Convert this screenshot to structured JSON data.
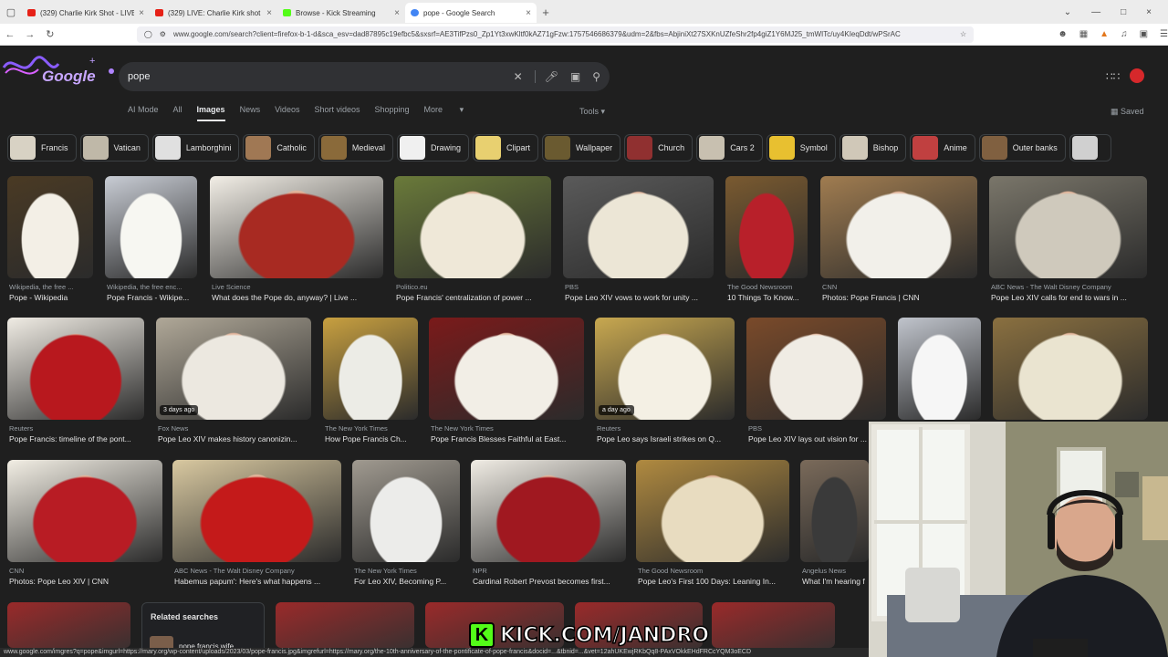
{
  "browser": {
    "tabs": [
      {
        "title": "(329) Charlie Kirk Shot - LIVE B",
        "color": "#e62117"
      },
      {
        "title": "(329) LIVE: Charlie Kirk shot and",
        "color": "#e62117"
      },
      {
        "title": "Browse - Kick Streaming",
        "color": "#53fc18"
      },
      {
        "title": "pope - Google Search",
        "color": "#ffffff",
        "active": true
      }
    ],
    "url": "www.google.com/search?client=firefox-b-1-d&sca_esv=dad87895c19efbc5&sxsrf=AE3TifPzs0_Zp1Yt3xwKltf0kAZ71gFzw:1757546686379&udm=2&fbs=AbjiniXt27SXKnUZfeShr2fp4giZ1Y6MJ25_tmWITc/uy4KIeqDdt/wPSrAC"
  },
  "search": {
    "query": "pope",
    "nav": [
      "AI Mode",
      "All",
      "Images",
      "News",
      "Videos",
      "Short videos",
      "Shopping",
      "More"
    ],
    "active_nav": "Images",
    "tools": "Tools",
    "saved": "Saved"
  },
  "chips": [
    {
      "label": "Francis",
      "color": "#d8d2c4"
    },
    {
      "label": "Vatican",
      "color": "#bfb8a8"
    },
    {
      "label": "Lamborghini",
      "color": "#e0e0e0"
    },
    {
      "label": "Catholic",
      "color": "#a07854"
    },
    {
      "label": "Medieval",
      "color": "#8a6a3a"
    },
    {
      "label": "Drawing",
      "color": "#f0f0f0"
    },
    {
      "label": "Clipart",
      "color": "#e8d070"
    },
    {
      "label": "Wallpaper",
      "color": "#6a5a30"
    },
    {
      "label": "Church",
      "color": "#903030"
    },
    {
      "label": "Cars 2",
      "color": "#c8c0b0"
    },
    {
      "label": "Symbol",
      "color": "#e8c030"
    },
    {
      "label": "Bishop",
      "color": "#d0c8b8"
    },
    {
      "label": "Anime",
      "color": "#c04040"
    },
    {
      "label": "Outer banks",
      "color": "#806040"
    },
    {
      "label": "",
      "color": "#d0d0d0"
    }
  ],
  "results": [
    {
      "source": "Wikipedia, the free ...",
      "caption": "Pope - Wikipedia",
      "c1": "#f3efe6",
      "c2": "#4a3a24"
    },
    {
      "source": "Wikipedia, the free enc...",
      "caption": "Pope Francis - Wikipe...",
      "c1": "#f7f7f2",
      "c2": "#c8ccd4"
    },
    {
      "source": "Live Science",
      "caption": "What does the Pope do, anyway? | Live ...",
      "c1": "#a82a22",
      "c2": "#f2eee6"
    },
    {
      "source": "Politico.eu",
      "caption": "Pope Francis' centralization of power ...",
      "c1": "#efe8d8",
      "c2": "#6a7a3a"
    },
    {
      "source": "PBS",
      "caption": "Pope Leo XIV vows to work for unity ...",
      "c1": "#ece6d6",
      "c2": "#5a5a5a"
    },
    {
      "source": "The Good Newsroom",
      "caption": "10 Things To Know...",
      "c1": "#b8202a",
      "c2": "#7a5a30"
    },
    {
      "source": "CNN",
      "caption": "Photos: Pope Francis | CNN",
      "c1": "#f2f0ea",
      "c2": "#a07c50"
    },
    {
      "source": "ABC News - The Walt Disney Company",
      "caption": "Pope Leo XIV calls for end to wars in ...",
      "c1": "#cfc9bc",
      "c2": "#7a766a"
    },
    {
      "source": "Reuters",
      "caption": "Pope Francis: timeline of the pont...",
      "c1": "#b8181e",
      "c2": "#f0ece4"
    },
    {
      "source": "Fox News",
      "caption": "Pope Leo XIV makes history canonizin...",
      "c1": "#ece8e0",
      "c2": "#b0a898",
      "badge": "3 days ago"
    },
    {
      "source": "The New York Times",
      "caption": "How Pope Francis Ch...",
      "c1": "#ecece6",
      "c2": "#c8a040"
    },
    {
      "source": "The New York Times",
      "caption": "Pope Francis Blesses Faithful at East...",
      "c1": "#f2eee6",
      "c2": "#7a1a1a"
    },
    {
      "source": "Reuters",
      "caption": "Pope Leo says Israeli strikes on Q...",
      "c1": "#f4f0e4",
      "c2": "#c8a850",
      "badge": "a day ago"
    },
    {
      "source": "PBS",
      "caption": "Pope Leo XIV lays out vision for ...",
      "c1": "#f0ece4",
      "c2": "#7a4a2a"
    },
    {
      "source": "",
      "caption": "",
      "c1": "#f6f6f6",
      "c2": "#c0c4cc"
    },
    {
      "source": "",
      "caption": "",
      "c1": "#eae4d0",
      "c2": "#8a7040"
    },
    {
      "source": "CNN",
      "caption": "Photos: Pope Leo XIV | CNN",
      "c1": "#b81c24",
      "c2": "#f2eee4"
    },
    {
      "source": "ABC News - The Walt Disney Company",
      "caption": "Habemus papum': Here's what happens ...",
      "c1": "#c41a1a",
      "c2": "#d8c8a0"
    },
    {
      "source": "The New York Times",
      "caption": "For Leo XIV, Becoming P...",
      "c1": "#ececea",
      "c2": "#a09a90"
    },
    {
      "source": "NPR",
      "caption": "Cardinal Robert Prevost becomes first...",
      "c1": "#a01820",
      "c2": "#f0ece4"
    },
    {
      "source": "The Good Newsroom",
      "caption": "Pope Leo's First 100 Days: Leaning In...",
      "c1": "#e8dcc0",
      "c2": "#b08a40"
    },
    {
      "source": "Angelus News",
      "caption": "What I'm hearing f",
      "c1": "#3a3a3a",
      "c2": "#7a6a5a"
    }
  ],
  "related": {
    "title": "Related searches",
    "query": "pope francis wife"
  },
  "overlay": {
    "kick_text": "KICK.COM/JANDRO"
  },
  "status_url": "www.google.com/imgres?q=pope&imgurl=https://mary.org/wp-content/uploads/2023/03/pope-francis.jpg&imgrefurl=https://mary.org/the-10th-anniversary-of-the-pontificate-of-pope-francis&docid=...&tbnid=...&vet=12ahUKEwjRKbQq8-PAxVOkkEHdFRCcYQM3oECD"
}
